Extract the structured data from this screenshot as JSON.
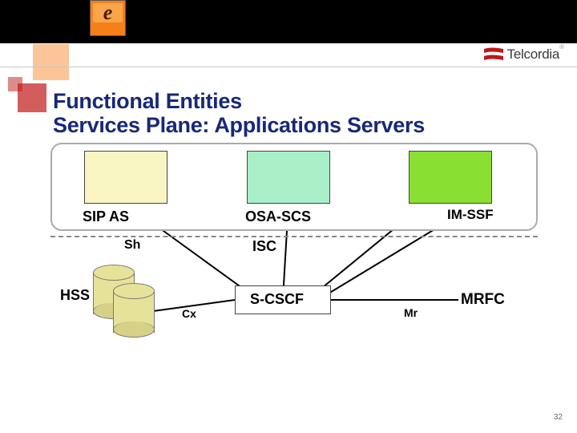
{
  "logo": {
    "text": "Telcordia",
    "mark_color": "#c01818",
    "trademark": "®"
  },
  "title": {
    "line1": "Functional Entities",
    "line2": "Services Plane: Applications Servers"
  },
  "top_decor": {
    "e_glyph": "e",
    "caption": ""
  },
  "blocks": {
    "sip_as": {
      "label": "SIP AS",
      "color": "#faf6c4"
    },
    "osa_scs": {
      "label": "OSA-SCS",
      "color": "#a8efc8"
    },
    "im_ssf": {
      "label": "IM-SSF",
      "color": "#8adf33"
    }
  },
  "interfaces": {
    "sh": "Sh",
    "isc": "ISC",
    "cx": "Cx",
    "mr": "Mr"
  },
  "nodes": {
    "hss": "HSS",
    "scscf": "S-CSCF",
    "mrfc": "MRFC"
  },
  "page_number": "32",
  "colors": {
    "title": "#182878",
    "accent_red": "#c01818",
    "accent_orange": "#f77f1a"
  }
}
